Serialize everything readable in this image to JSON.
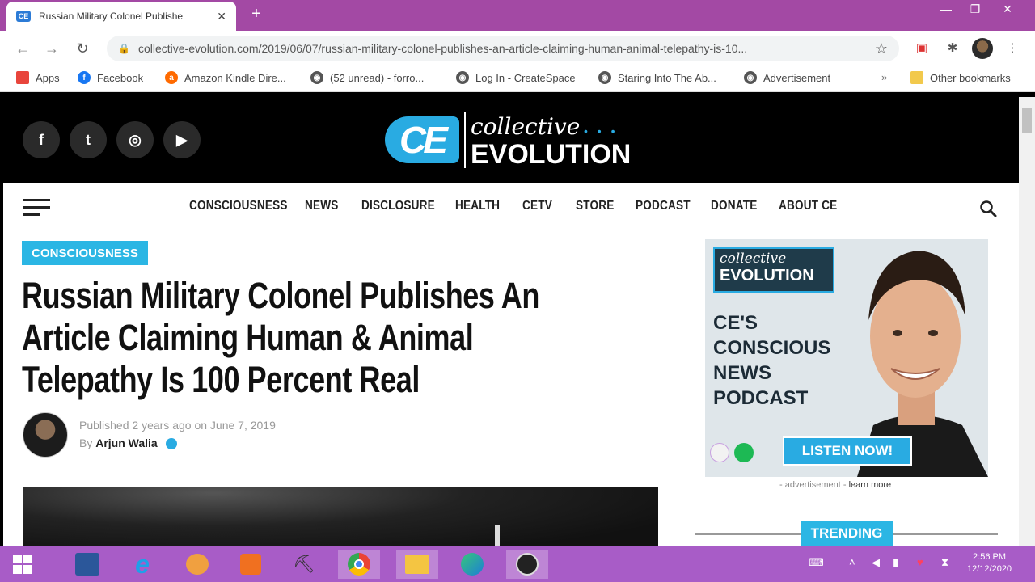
{
  "browser": {
    "tab_title": "Russian Military Colonel Publishe",
    "tab_favicon": "CE",
    "new_tab": "+",
    "url": "collective-evolution.com/2019/06/07/russian-military-colonel-publishes-an-article-claiming-human-animal-telepathy-is-10...",
    "bookmarks": [
      {
        "label": "Apps",
        "icon": "apps-grid-icon",
        "color": "#e8453c"
      },
      {
        "label": "Facebook",
        "icon": "facebook-icon",
        "color": "#1877f2"
      },
      {
        "label": "Amazon Kindle Dire...",
        "icon": "amazon-icon",
        "color": "#ff6a00"
      },
      {
        "label": "(52 unread) - forro...",
        "icon": "globe-icon",
        "color": "#555555"
      },
      {
        "label": "Log In - CreateSpace",
        "icon": "globe-icon",
        "color": "#555555"
      },
      {
        "label": "Staring Into The Ab...",
        "icon": "globe-icon",
        "color": "#555555"
      },
      {
        "label": "Advertisement",
        "icon": "globe-icon",
        "color": "#555555"
      }
    ],
    "bookmarks_more": "»",
    "other_bookmarks": "Other bookmarks"
  },
  "site": {
    "logo_mark": "CE",
    "logo_top": "collective",
    "logo_dots": "• • •",
    "logo_bottom": "EVOLUTION",
    "social": [
      {
        "label": "f",
        "icon": "facebook-icon"
      },
      {
        "label": "t",
        "icon": "twitter-icon"
      },
      {
        "label": "◎",
        "icon": "instagram-icon"
      },
      {
        "label": "▶",
        "icon": "youtube-icon"
      }
    ],
    "nav": [
      "CONSCIOUSNESS",
      "NEWS",
      "DISCLOSURE",
      "HEALTH",
      "CETV",
      "STORE",
      "PODCAST",
      "DONATE",
      "ABOUT CE"
    ]
  },
  "article": {
    "category": "CONSCIOUSNESS",
    "headline_lines": [
      "Russian Military Colonel Publishes An",
      "Article Claiming Human & Animal",
      "Telepathy Is 100 Percent Real"
    ],
    "published_prefix": "Published",
    "published_rel": "2 years ago",
    "published_on": "on",
    "published_date": "June 7, 2019",
    "by": "By",
    "author": "Arjun Walia"
  },
  "ad": {
    "logo_top": "collective",
    "logo_bottom": "EVOLUTION",
    "text": "CE'S\nCONSCIOUS\nNEWS\nPODCAST",
    "cta": "LISTEN NOW!",
    "note_prefix": "- advertisement -",
    "note_link": "learn more"
  },
  "sidebar": {
    "trending": "TRENDING"
  },
  "taskbar": {
    "time": "2:56 PM",
    "date": "12/12/2020"
  },
  "colors": {
    "accent": "#29abe2",
    "tabstrip": "#a349a4",
    "taskbar": "#a85cc7"
  }
}
